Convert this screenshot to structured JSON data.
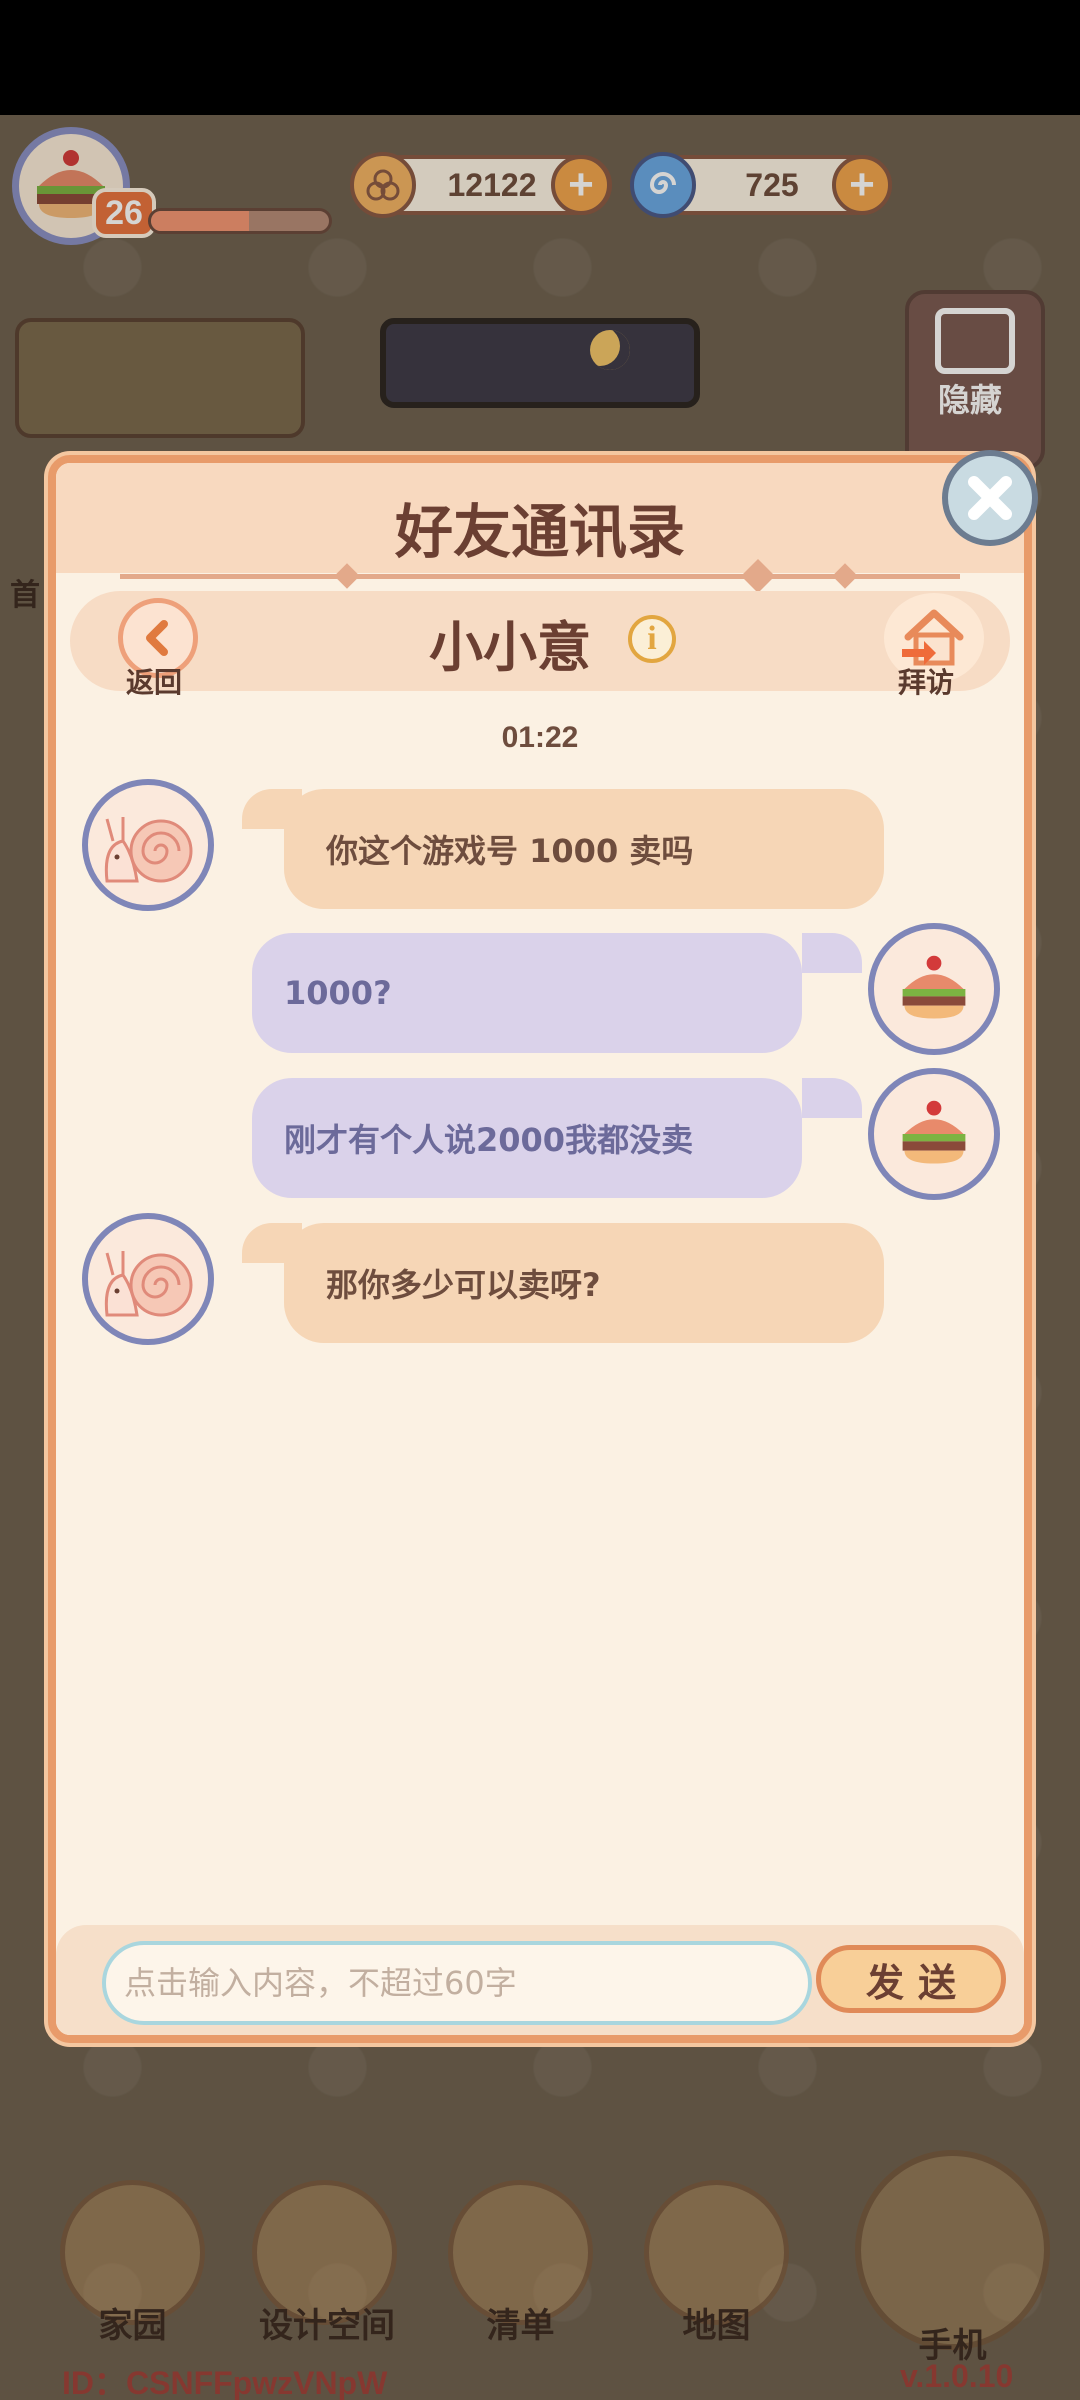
{
  "hud": {
    "level": "26",
    "xp_progress": 0.55,
    "coins": "12122",
    "gems": "725"
  },
  "side": {
    "hide_label": "隐藏",
    "home_label": "首"
  },
  "dialog": {
    "title": "好友通讯录",
    "back_label": "返回",
    "friend_name": "小小意",
    "visit_label": "拜访",
    "timestamp": "01:22",
    "messages": [
      {
        "sender": "friend",
        "text": "你这个游戏号  1000  卖吗"
      },
      {
        "sender": "me",
        "text": "1000?"
      },
      {
        "sender": "me",
        "text": "刚才有个人说2000我都没卖"
      },
      {
        "sender": "friend",
        "text": "那你多少可以卖呀?"
      }
    ],
    "input_placeholder": "点击输入内容，不超过60字",
    "input_value": "",
    "send_label": "发送"
  },
  "nav": {
    "items": [
      {
        "label": "家园"
      },
      {
        "label": "设计空间"
      },
      {
        "label": "清单"
      },
      {
        "label": "地图"
      },
      {
        "label": "手机"
      }
    ]
  },
  "footer": {
    "id_text": "ID：CSNFFpwzVNpW",
    "version": "v.1.0.10"
  },
  "colors": {
    "dialog_bg": "#fbf1e3",
    "friend_bubble": "#f6d6b6",
    "my_bubble": "#dad2ea",
    "accent": "#e89b6a"
  }
}
